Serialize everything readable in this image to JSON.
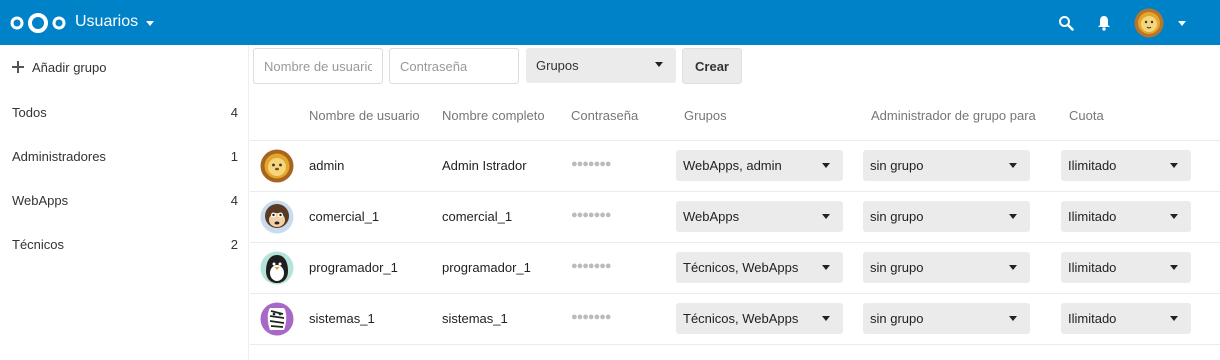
{
  "header": {
    "app_title": "Usuarios"
  },
  "sidebar": {
    "add_group_label": "Añadir grupo",
    "groups": [
      {
        "label": "Todos",
        "count": "4"
      },
      {
        "label": "Administradores",
        "count": "1"
      },
      {
        "label": "WebApps",
        "count": "4"
      },
      {
        "label": "Técnicos",
        "count": "2"
      }
    ]
  },
  "controls": {
    "username_placeholder": "Nombre de usuario",
    "password_placeholder": "Contraseña",
    "groups_select": "Grupos",
    "create_button": "Crear"
  },
  "table": {
    "columns": {
      "username": "Nombre de usuario",
      "fullname": "Nombre completo",
      "password": "Contraseña",
      "groups": "Grupos",
      "subadmin": "Administrador de grupo para",
      "quota": "Cuota"
    },
    "rows": [
      {
        "username": "admin",
        "fullname": "Admin Istrador",
        "password": "●●●●●●●",
        "groups": "WebApps, admin",
        "subadmin": "sin grupo",
        "quota": "Ilimitado",
        "avatar": "lion-avatar"
      },
      {
        "username": "comercial_1",
        "fullname": "comercial_1",
        "password": "●●●●●●●",
        "groups": "WebApps",
        "subadmin": "sin grupo",
        "quota": "Ilimitado",
        "avatar": "monkey-avatar"
      },
      {
        "username": "programador_1",
        "fullname": "programador_1",
        "password": "●●●●●●●",
        "groups": "Técnicos, WebApps",
        "subadmin": "sin grupo",
        "quota": "Ilimitado",
        "avatar": "penguin-avatar"
      },
      {
        "username": "sistemas_1",
        "fullname": "sistemas_1",
        "password": "●●●●●●●",
        "groups": "Técnicos, WebApps",
        "subadmin": "sin grupo",
        "quota": "Ilimitado",
        "avatar": "zebra-avatar"
      }
    ]
  },
  "colors": {
    "header_bg": "#0082c9",
    "dropdown_bg": "#ebebeb"
  }
}
